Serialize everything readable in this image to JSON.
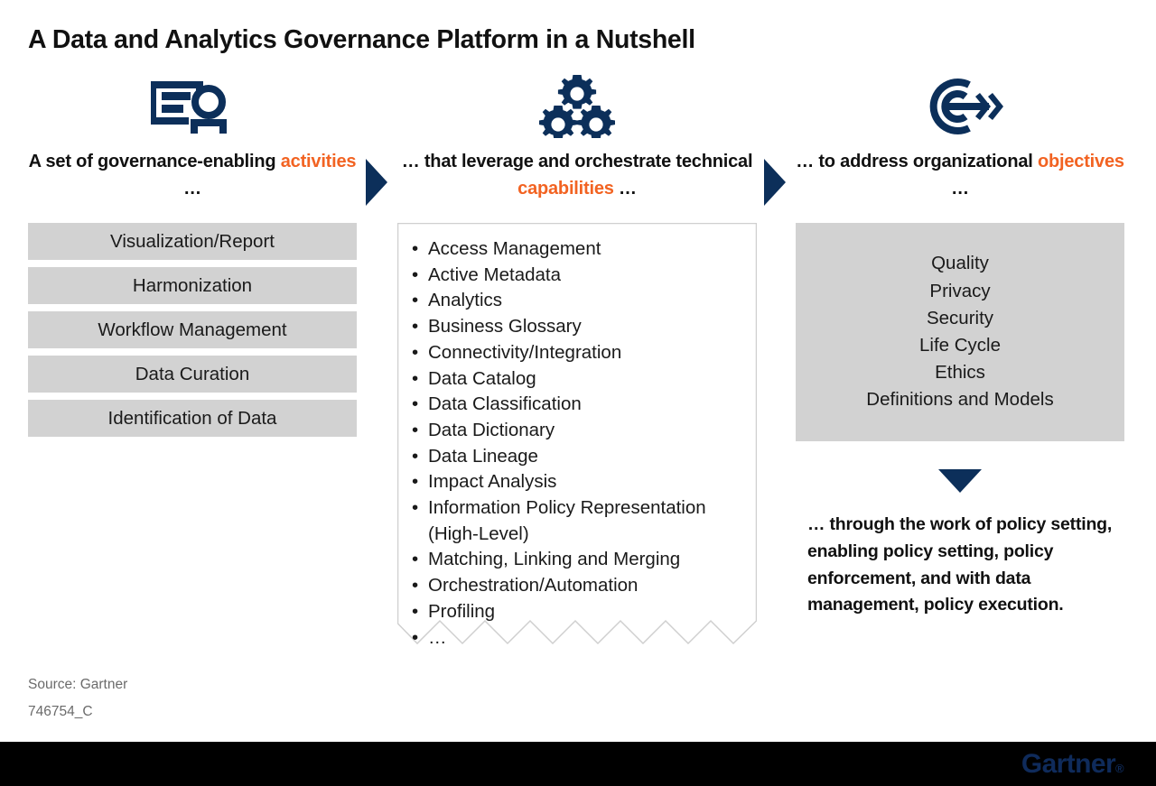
{
  "title": "A Data and Analytics Governance Platform in a Nutshell",
  "colors": {
    "navy": "#0c2f5a",
    "orange": "#f26322",
    "gray_bar": "#d2d2d2",
    "footer": "#000000",
    "logo_blue": "#0f2b5b"
  },
  "columns": {
    "left": {
      "icon": "id-badge-person-icon",
      "heading_pre": "A set of governance-enabling ",
      "heading_highlight": "activities",
      "heading_post": " …",
      "items": [
        "Visualization/Report",
        "Harmonization",
        "Workflow Management",
        "Data Curation",
        "Identification of Data"
      ]
    },
    "middle": {
      "icon": "three-gears-icon",
      "heading_pre": "… that leverage and orchestrate technical ",
      "heading_highlight": "capabilities",
      "heading_post": " …",
      "items": [
        "Access Management",
        "Active Metadata",
        "Analytics",
        "Business Glossary",
        "Connectivity/Integration",
        "Data Catalog",
        "Data Classification",
        "Data Dictionary",
        "Data Lineage",
        "Impact Analysis",
        "Information Policy Representation (High-Level)",
        "Matching, Linking and Merging",
        "Orchestration/Automation",
        "Profiling",
        "…"
      ]
    },
    "right": {
      "icon": "target-arrow-icon",
      "heading_pre": "… to address organizational ",
      "heading_highlight": "objectives",
      "heading_post": " …",
      "items": [
        "Quality",
        "Privacy",
        "Security",
        "Life Cycle",
        "Ethics",
        "Definitions and Models"
      ],
      "closing_text": "… through the work of policy setting, enabling policy setting, policy enforcement, and with data management, policy execution."
    }
  },
  "arrows": {
    "arrow_1": "right-triangle-arrow",
    "arrow_2": "right-triangle-arrow",
    "arrow_3": "down-triangle-arrow"
  },
  "source": {
    "line1": "Source: Gartner",
    "line2": "746754_C"
  },
  "footer": {
    "logo_text": "Gartner",
    "logo_mark": "®"
  }
}
